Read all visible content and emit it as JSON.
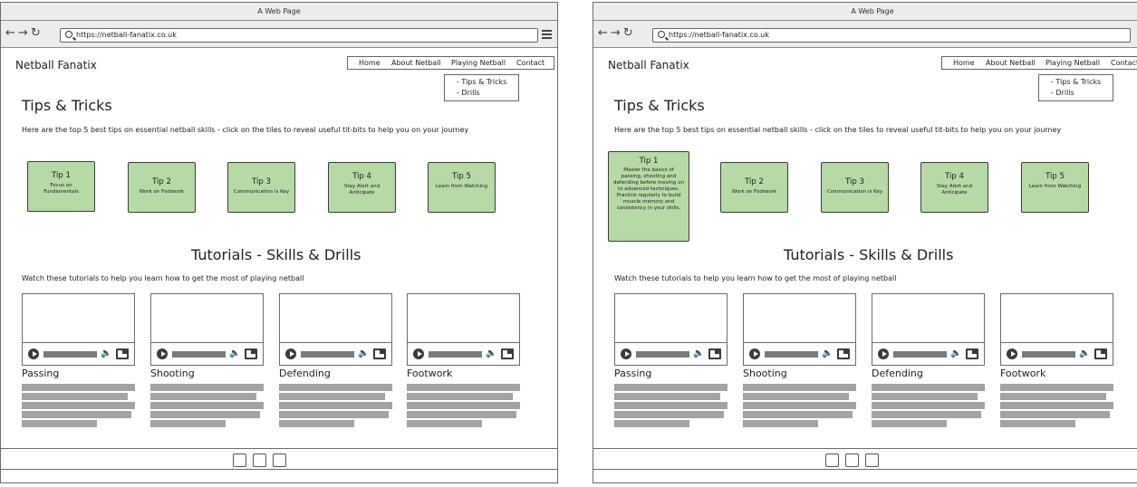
{
  "window_title": "A Web Page",
  "url": "https://netball-fanatix.co.uk",
  "brand": "Netball Fanatix",
  "nav": [
    "Home",
    "About Netball",
    "Playing Netball",
    "Contact"
  ],
  "submenu": [
    "- Tips & Tricks",
    "- Drills"
  ],
  "tips_heading": "Tips & Tricks",
  "tips_intro": "Here are the top 5 best tips on essential netball skills - click on the tiles to reveal useful tit-bits to help you on your journey",
  "tips": [
    {
      "title": "Tip 1",
      "desc": "Focus on Fundamentals"
    },
    {
      "title": "Tip 2",
      "desc": "Work on Footwork"
    },
    {
      "title": "Tip 3",
      "desc": "Communication is Key"
    },
    {
      "title": "Tip 4",
      "desc": "Stay Alert and Anticipate"
    },
    {
      "title": "Tip 5",
      "desc": "Learn from Watching"
    }
  ],
  "tip1_expanded": "Master the basics of passing, shooting and defending before moving on to advanced techniques. Practice regularly to build muscle memory and consistency in your skills.",
  "tutorials_heading": "Tutorials - Skills & Drills",
  "tutorials_intro": "Watch these tutorials to help you learn how to get the most of playing netball",
  "videos": [
    "Passing",
    "Shooting",
    "Defending",
    "Footwork"
  ],
  "colors": {
    "tile_green": "#b7d9a6",
    "placeholder_grey": "#a3a3a3",
    "chrome": "#ececec"
  },
  "icons": [
    "back-arrow-icon",
    "forward-arrow-icon",
    "refresh-icon",
    "search-icon",
    "hamburger-menu-icon",
    "play-icon",
    "volume-icon",
    "fullscreen-icon"
  ]
}
